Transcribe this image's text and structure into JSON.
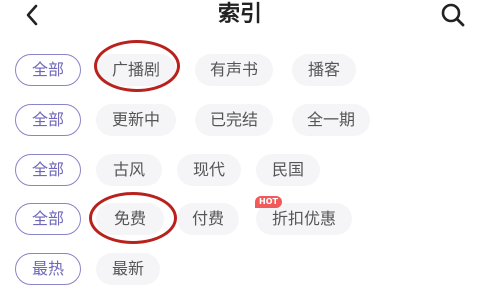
{
  "header": {
    "title": "索引"
  },
  "rows": [
    {
      "items": [
        "全部",
        "广播剧",
        "有声书",
        "播客"
      ]
    },
    {
      "items": [
        "全部",
        "更新中",
        "已完结",
        "全一期"
      ]
    },
    {
      "items": [
        "全部",
        "古风",
        "现代",
        "民国"
      ]
    },
    {
      "items": [
        "全部",
        "免费",
        "付费",
        "折扣优惠"
      ],
      "badge": "HOT"
    },
    {
      "items": [
        "最热",
        "最新"
      ]
    }
  ],
  "colors": {
    "selected_border": "#8a84c9",
    "selected_text": "#6e67bb",
    "chip_bg": "#f5f5f7",
    "annotation_circle": "#b8211c",
    "hot_badge": "#f05a5a"
  }
}
